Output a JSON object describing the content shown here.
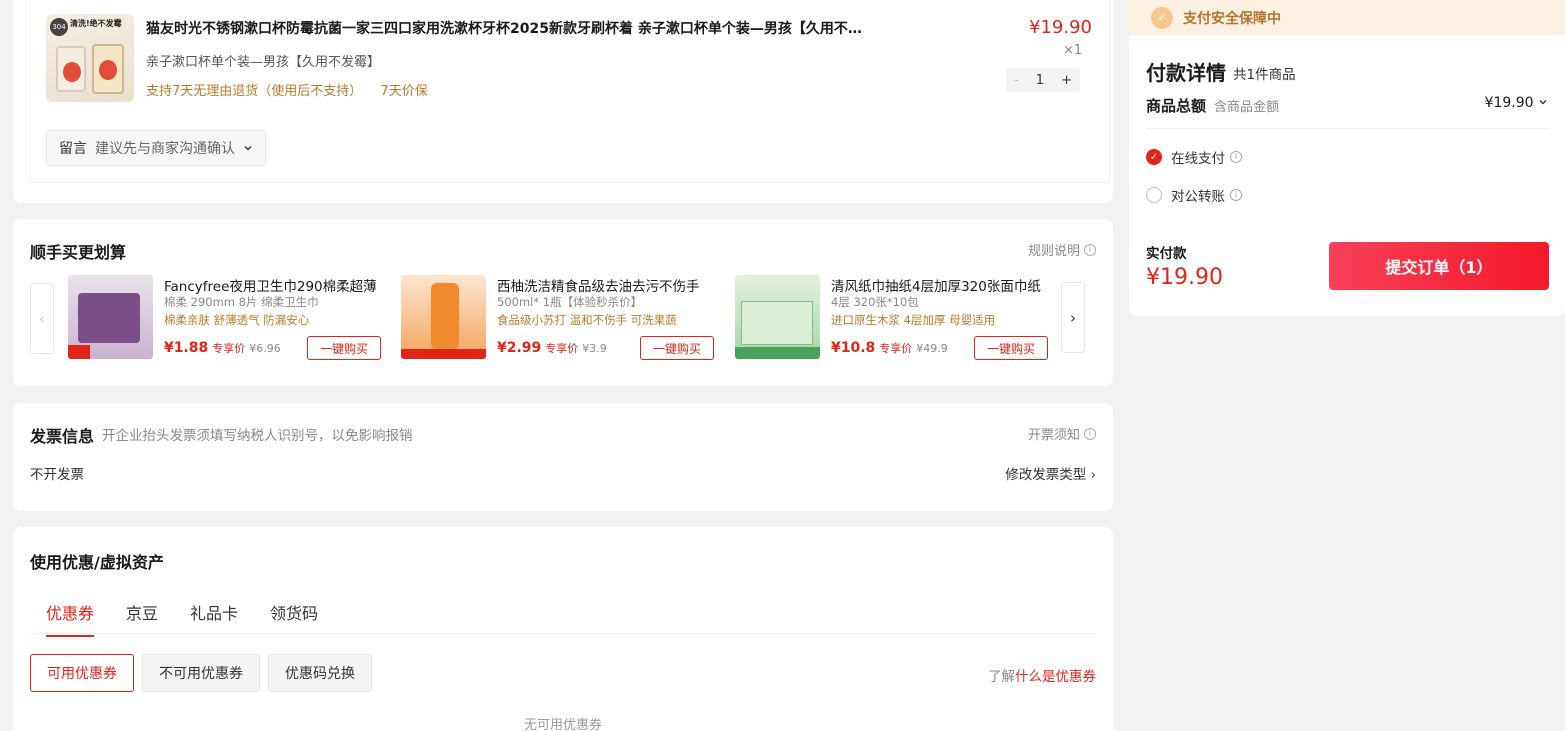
{
  "product": {
    "thumb_badge": "304",
    "thumb_header": "清洗!绝不发霉",
    "title": "猫友时光不锈钢漱口杯防霉抗菌一家三四口家用洗漱杯牙杯2025新款牙刷杯着 亲子漱口杯单个装—男孩【久用不发…",
    "spec": "亲子漱口杯单个装—男孩【久用不发霉】",
    "services": [
      "支持7天无理由退货（使用后不支持）",
      "7天价保"
    ],
    "price": "¥19.90",
    "qty_label": "×1",
    "stepper": {
      "minus": "-",
      "value": "1",
      "plus": "+"
    },
    "message": {
      "label": "留言",
      "placeholder": "建议先与商家沟通确认"
    }
  },
  "addon": {
    "title": "顺手买更划算",
    "rule_link": "规则说明",
    "prev_icon": "‹",
    "next_icon": "›",
    "items": [
      {
        "name": "Fancyfree夜用卫生巾290棉柔超薄",
        "spec": "棉柔 290mm 8片 绵柔卫生巾",
        "selling": "棉柔亲肤 舒薄透气 防漏安心",
        "price": "¥1.88",
        "price_tag": "专享价",
        "orig": "¥6.96",
        "buy": "一键购买",
        "color": "#d9c6d6"
      },
      {
        "name": "西柚洗洁精食品级去油去污不伤手",
        "spec": "500ml* 1瓶【体验秒杀价】",
        "selling": "食品级小苏打 温和不伤手 可洗果蔬",
        "price": "¥2.99",
        "price_tag": "专享价",
        "orig": "¥3.9",
        "buy": "一键购买",
        "color": "#f7c28a"
      },
      {
        "name": "清风纸巾抽纸4层加厚320张面巾纸",
        "spec": "4层 320张*10包",
        "selling": "进口原生木浆 4层加厚 母婴适用",
        "price": "¥10.8",
        "price_tag": "专享价",
        "orig": "¥49.9",
        "buy": "一键购买",
        "color": "#bfe0c4"
      }
    ]
  },
  "invoice": {
    "title": "发票信息",
    "note": "开企业抬头发票须填写纳税人识别号，以免影响报销",
    "notice_link": "开票须知",
    "value": "不开发票",
    "modify": "修改发票类型"
  },
  "coupon": {
    "title": "使用优惠/虚拟资产",
    "tabs": [
      "优惠券",
      "京豆",
      "礼品卡",
      "领货码"
    ],
    "buttons": [
      "可用优惠券",
      "不可用优惠券",
      "优惠码兑换"
    ],
    "learn_prefix": "了解",
    "learn_link": "什么是优惠券",
    "empty": "无可用优惠券"
  },
  "payment": {
    "secure": "支付安全保障中",
    "title": "付款详情",
    "count": "共1件商品",
    "total_label": "商品总额",
    "total_sub": "含商品金额",
    "total_value": "¥19.90",
    "methods": [
      "在线支付",
      "对公转账"
    ],
    "real_label": "实付款",
    "real_value": "¥19.90",
    "submit": "提交订单（1）"
  }
}
